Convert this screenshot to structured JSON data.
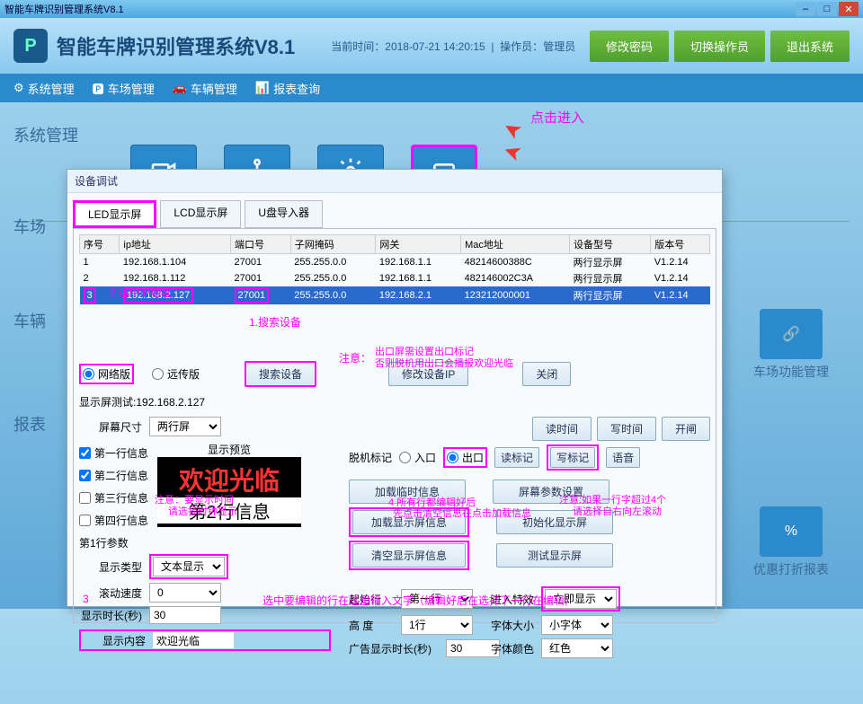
{
  "titlebar": {
    "title": "智能车牌识别管理系统V8.1"
  },
  "header": {
    "logo_text": "P",
    "app_title": "智能车牌识别管理系统V8.1",
    "now_label": "当前时间：",
    "now_value": "2018-07-21 14:20:15",
    "operator_label": "操作员：",
    "operator_value": "管理员",
    "btn_change_pwd": "修改密码",
    "btn_switch_op": "切换操作员",
    "btn_exit": "退出系统"
  },
  "menu": {
    "sys_mgmt": "系统管理",
    "parking_mgmt": "车场管理",
    "vehicle_mgmt": "车辆管理",
    "report_query": "报表查询"
  },
  "sections": {
    "sys_mgmt": "系统管理",
    "parking_mgmt": "车场",
    "vehicle_mgmt": "车辆",
    "report_check": "报表"
  },
  "tiles": {
    "online_monitor": "在线监控",
    "perm_mgmt": "权限管理",
    "sys_setting": "系统设置",
    "device_debug": "设备调试"
  },
  "right_tiles": {
    "park_func": "车场功能管理",
    "discount_report": "优惠打折报表"
  },
  "annotations": {
    "click_enter": "点击进入",
    "select_ip": "选中IP地址",
    "step2": "2",
    "search_device": "搜索设备",
    "step1": "1.",
    "note1": "出口屏需设置出口标记",
    "note1b": "否则脱机用出口会播报欢迎光临",
    "note_label": "注意：",
    "step4": "4",
    "after_edit": "所有行都编辑好后",
    "clear_load": "先点击清空信息在点击加载信息",
    "note3": "注意:如果一行字超过4个",
    "note3b": "请选择自右向左滚动",
    "show_time_note1": "注意：要显示时间",
    "show_time_note2": "请选择时钟显示",
    "step3": "3",
    "input_here": "选中要编辑的行在这里输入文字（编辑好后在选择下一行在编辑）"
  },
  "dialog": {
    "title": "设备调试",
    "tabs": {
      "led": "LED显示屏",
      "lcd": "LCD显示屏",
      "udisk": "U盘导入器"
    },
    "table": {
      "headers": {
        "seq": "序号",
        "ip": "ip地址",
        "port": "端口号",
        "subnet": "子网掩码",
        "gateway": "网关",
        "mac": "Mac地址",
        "model": "设备型号",
        "version": "版本号"
      },
      "rows": [
        {
          "seq": "1",
          "ip": "192.168.1.104",
          "port": "27001",
          "subnet": "255.255.0.0",
          "gateway": "192.168.1.1",
          "mac": "48214600388C",
          "model": "两行显示屏",
          "version": "V1.2.14"
        },
        {
          "seq": "2",
          "ip": "192.168.1.112",
          "port": "27001",
          "subnet": "255.255.0.0",
          "gateway": "192.168.1.1",
          "mac": "482146002C3A",
          "model": "两行显示屏",
          "version": "V1.2.14"
        },
        {
          "seq": "3",
          "ip": "192.168.2.127",
          "port": "27001",
          "subnet": "255.255.0.0",
          "gateway": "192.168.2.1",
          "mac": "123212000001",
          "model": "两行显示屏",
          "version": "V1.2.14"
        }
      ]
    },
    "radio_network": "网络版",
    "radio_remote": "远传版",
    "btn_search": "搜索设备",
    "btn_modify_ip": "修改设备IP",
    "btn_close": "关闭",
    "screen_test_label": "显示屏测试:",
    "screen_test_value": "192.168.2.127",
    "screen_size_label": "屏幕尺寸",
    "screen_size_value": "两行屏",
    "chk_line1": "第一行信息",
    "chk_line2": "第二行信息",
    "chk_line3": "第三行信息",
    "chk_line4": "第四行信息",
    "preview_label": "显示预览",
    "preview_line1": "欢迎光临",
    "preview_line2": "第2行信息",
    "line1_params": "第1行参数",
    "disp_type_label": "显示类型",
    "disp_type_value": "文本显示",
    "scroll_speed_label": "滚动速度",
    "scroll_speed_value": "0",
    "disp_time_label": "显示时长(秒)",
    "disp_time_value": "30",
    "disp_content_label": "显示内容",
    "disp_content_value": "欢迎光临",
    "offline_mark_label": "脱机标记",
    "radio_entry": "入口",
    "radio_exit": "出口",
    "btn_read_mark": "读标记",
    "btn_write_mark": "写标记",
    "btn_voice": "语音",
    "btn_read_time": "读时间",
    "btn_write_time": "写时间",
    "btn_open_gate": "开闸",
    "btn_load_temp": "加载临时信息",
    "btn_screen_params": "屏幕参数设置",
    "btn_load_disp": "加载显示屏信息",
    "btn_init_disp": "初始化显示屏",
    "btn_clear_disp": "清空显示屏信息",
    "btn_test_disp": "测试显示屏",
    "start_line_label": "起始行",
    "start_line_value": "第一行",
    "height_label": "高 度",
    "height_value": "1行",
    "ad_time_label": "广告显示时长(秒)",
    "ad_time_value": "30",
    "enter_effect_label": "进入特效",
    "enter_effect_value": "立即显示",
    "font_size_label": "字体大小",
    "font_size_value": "小字体",
    "font_color_label": "字体颜色",
    "font_color_value": "红色"
  }
}
